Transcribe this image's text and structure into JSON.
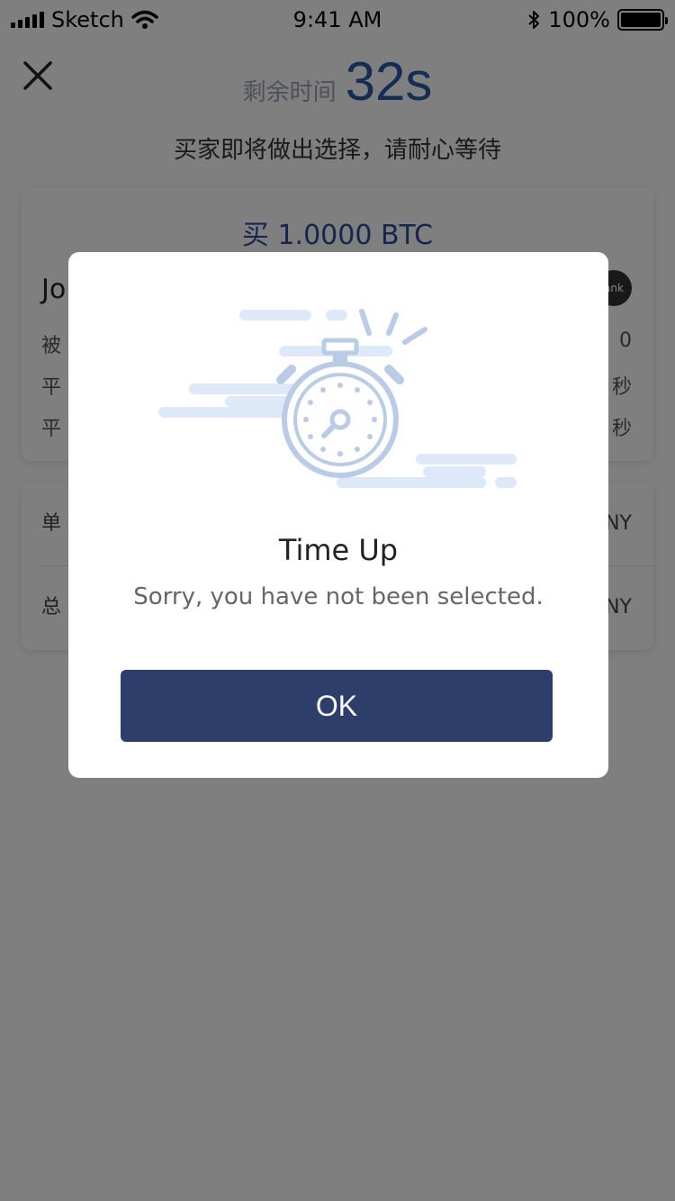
{
  "status_bar": {
    "carrier": "Sketch",
    "time": "9:41 AM",
    "battery_percent": "100%",
    "bluetooth_icon": "bluetooth-icon",
    "wifi_icon": "wifi-icon"
  },
  "header": {
    "close_icon": "close-icon",
    "timer_label": "剩余时间",
    "timer_value": "32s",
    "subtitle": "买家即将做出选择，请耐心等待"
  },
  "order": {
    "title": "买 1.0000 BTC",
    "trader_name": "Jo",
    "trader_badge": "ank",
    "rows": [
      {
        "label": "被",
        "value": "0"
      },
      {
        "label": "平",
        "value": "秒"
      },
      {
        "label": "平",
        "value": "秒"
      }
    ]
  },
  "price": {
    "rows": [
      {
        "label": "单",
        "value": "NY"
      },
      {
        "label": "总",
        "value": "NY"
      }
    ]
  },
  "modal": {
    "illustration_icon": "stopwatch-icon",
    "title": "Time Up",
    "message": "Sorry, you have not been selected.",
    "ok_label": "OK"
  },
  "colors": {
    "accent_blue": "#2a5aa8",
    "button_navy": "#2e3e6b",
    "illustration_light": "#dde8f8",
    "illustration_stroke": "#b9cbe6"
  }
}
